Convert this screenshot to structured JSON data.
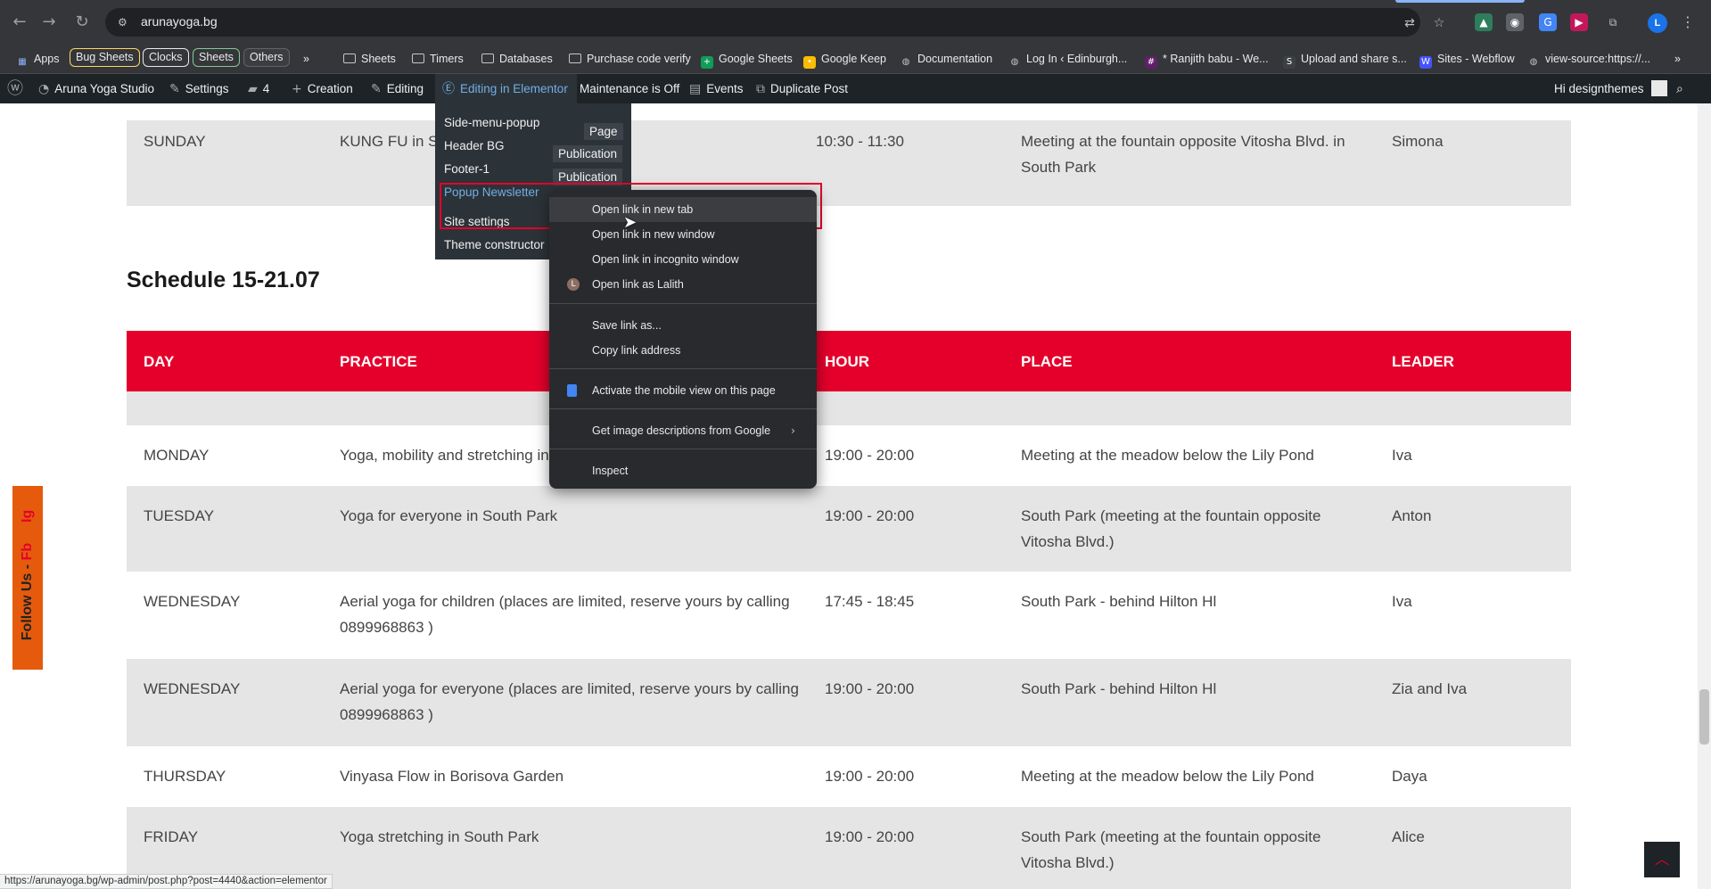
{
  "browser": {
    "url": "arunayoga.bg",
    "bookmarks": {
      "apps": "Apps",
      "chip_bug_sheets": "Bug Sheets",
      "chip_clocks": "Clocks",
      "chip_sheets": "Sheets",
      "others": "Others",
      "more": "»",
      "items": [
        "Sheets",
        "Timers",
        "Databases",
        "Purchase code verify",
        "Google Sheets",
        "Google Keep",
        "Documentation",
        "Log In ‹ Edinburgh...",
        "* Ranjith babu - We...",
        "Upload and share s...",
        "Sites - Webflow",
        "view-source:https://..."
      ],
      "overflow": "»"
    },
    "profile_initial": "L",
    "status_url": "https://arunayoga.bg/wp-admin/post.php?post=4440&action=elementor"
  },
  "wp_admin_bar": {
    "site_name": "Aruna Yoga Studio",
    "settings": "Settings",
    "comments_count": "4",
    "creation": "Creation",
    "editing": "Editing",
    "editing_elementor": "Editing in Elementor",
    "maintenance": "Maintenance is Off",
    "events": "Events",
    "duplicate": "Duplicate Post",
    "greeting": "Hi designthemes"
  },
  "elementor_menu": {
    "items": [
      "Side-menu-popup",
      "Header BG",
      "Footer-1",
      "Popup Newsletter",
      "Site settings",
      "Theme constructor"
    ],
    "badges": [
      "Page",
      "Publication",
      "Publication"
    ]
  },
  "context_menu": {
    "items": [
      "Open link in new tab",
      "Open link in new window",
      "Open link in incognito window",
      "Open link as Lalith",
      "Save link as...",
      "Copy link address",
      "Activate the mobile view on this page",
      "Get image descriptions from Google",
      "Inspect"
    ],
    "profile_initial": "L"
  },
  "schedule": {
    "prev_row": {
      "day": "SUNDAY",
      "practice": "KUNG FU in So",
      "hour": "10:30 - 11:30",
      "place": "Meeting at the fountain opposite Vitosha Blvd. in South Park",
      "leader": "Simona"
    },
    "title": "Schedule 15-21.07",
    "headers": {
      "day": "DAY",
      "practice": "PRACTICE",
      "hour": "HOUR",
      "place": "PLACE",
      "leader": "LEADER"
    },
    "rows": [
      {
        "day": "MONDAY",
        "practice": "Yoga, mobility and stretching in",
        "hour": "19:00 - 20:00",
        "place": "Meeting at the meadow below the Lily Pond",
        "leader": "Iva"
      },
      {
        "day": "TUESDAY",
        "practice": "Yoga for everyone in South Park",
        "hour": "19:00 - 20:00",
        "place": "South Park (meeting at the fountain opposite Vitosha Blvd.)",
        "leader": "Anton"
      },
      {
        "day": "WEDNESDAY",
        "practice": "Aerial yoga for children (places are limited, reserve yours by calling 0899968863 )",
        "hour": "17:45 - 18:45",
        "place": "South Park - behind Hilton Hl",
        "leader": "Iva"
      },
      {
        "day": "WEDNESDAY",
        "practice": "Aerial yoga for everyone (places are limited, reserve yours by calling 0899968863 )",
        "hour": "19:00 - 20:00",
        "place": "South Park - behind Hilton Hl",
        "leader": "Zia and Iva"
      },
      {
        "day": "THURSDAY",
        "practice": "Vinyasa Flow in Borisova Garden",
        "hour": "19:00 - 20:00",
        "place": "Meeting at the meadow below the Lily Pond",
        "leader": "Daya"
      },
      {
        "day": "FRIDAY",
        "practice": "Yoga stretching in South Park",
        "hour": "19:00 - 20:00",
        "place": "South Park (meeting at the fountain opposite Vitosha Blvd.)",
        "leader": "Alice"
      }
    ]
  },
  "follow": {
    "label": "Follow Us -",
    "fb": "Fb",
    "ig": "Ig"
  },
  "colors": {
    "accent_red": "#e4002b",
    "follow_orange": "#e55a0c",
    "wp_bar": "#1d2327"
  }
}
